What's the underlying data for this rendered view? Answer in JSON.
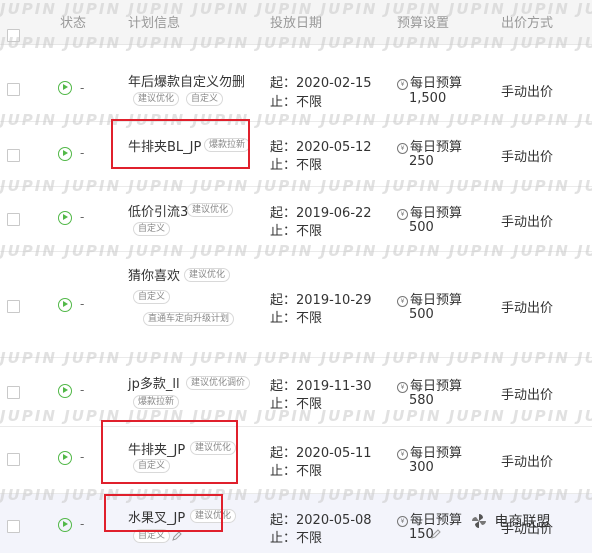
{
  "header": {
    "col_status": "状态",
    "col_plan": "计划信息",
    "col_date": "投放日期",
    "col_budget": "预算设置",
    "col_method": "出价方式"
  },
  "watermark": "JUPIN JUPIN JUPIN JUPIN JUPIN JUPIN JUPIN JUPIN JUPIN JUPIN",
  "rows": [
    {
      "name": "年后爆款自定义勿删",
      "tags": [
        "建议优化",
        "自定义"
      ],
      "start": "起：2020-02-15",
      "end": "止：不限",
      "budget_label": "每日预算",
      "budget_value": "1,500",
      "method": "手动出价",
      "dash": "-"
    },
    {
      "name": "牛排夹BL_JP",
      "tags": [
        "爆款拉新"
      ],
      "start": "起：2020-05-12",
      "end": "止：不限",
      "budget_label": "每日预算",
      "budget_value": "250",
      "method": "手动出价",
      "dash": "-"
    },
    {
      "name": "低价引流3",
      "tags": [
        "建议优化",
        "自定义"
      ],
      "start": "起：2019-06-22",
      "end": "止：不限",
      "budget_label": "每日预算",
      "budget_value": "500",
      "method": "手动出价",
      "dash": "-"
    },
    {
      "name": "猜你喜欢",
      "tags": [
        "建议优化",
        "自定义",
        "直通车定向升级计划"
      ],
      "start": "起：2019-10-29",
      "end": "止：不限",
      "budget_label": "每日预算",
      "budget_value": "500",
      "method": "手动出价",
      "dash": "-"
    },
    {
      "name": "jp多款_ll",
      "tags": [
        "建议优化调价",
        "爆款拉新"
      ],
      "start": "起：2019-11-30",
      "end": "止：不限",
      "budget_label": "每日预算",
      "budget_value": "580",
      "method": "手动出价",
      "dash": "-"
    },
    {
      "name": "牛排夹_JP",
      "tags": [
        "建议优化",
        "自定义"
      ],
      "start": "起：2020-05-11",
      "end": "止：不限",
      "budget_label": "每日预算",
      "budget_value": "300",
      "method": "手动出价",
      "dash": "-"
    },
    {
      "name": "水果叉_JP",
      "tags": [
        "建议优化",
        "自定义"
      ],
      "start": "起：2020-05-08",
      "end": "止：不限",
      "budget_label": "每日预算",
      "budget_value": "150",
      "method": "手动出价",
      "dash": "-"
    }
  ],
  "logo_text": "电商联盟",
  "colors": {
    "highlight": "#e0202c",
    "status_green": "#52b848"
  }
}
